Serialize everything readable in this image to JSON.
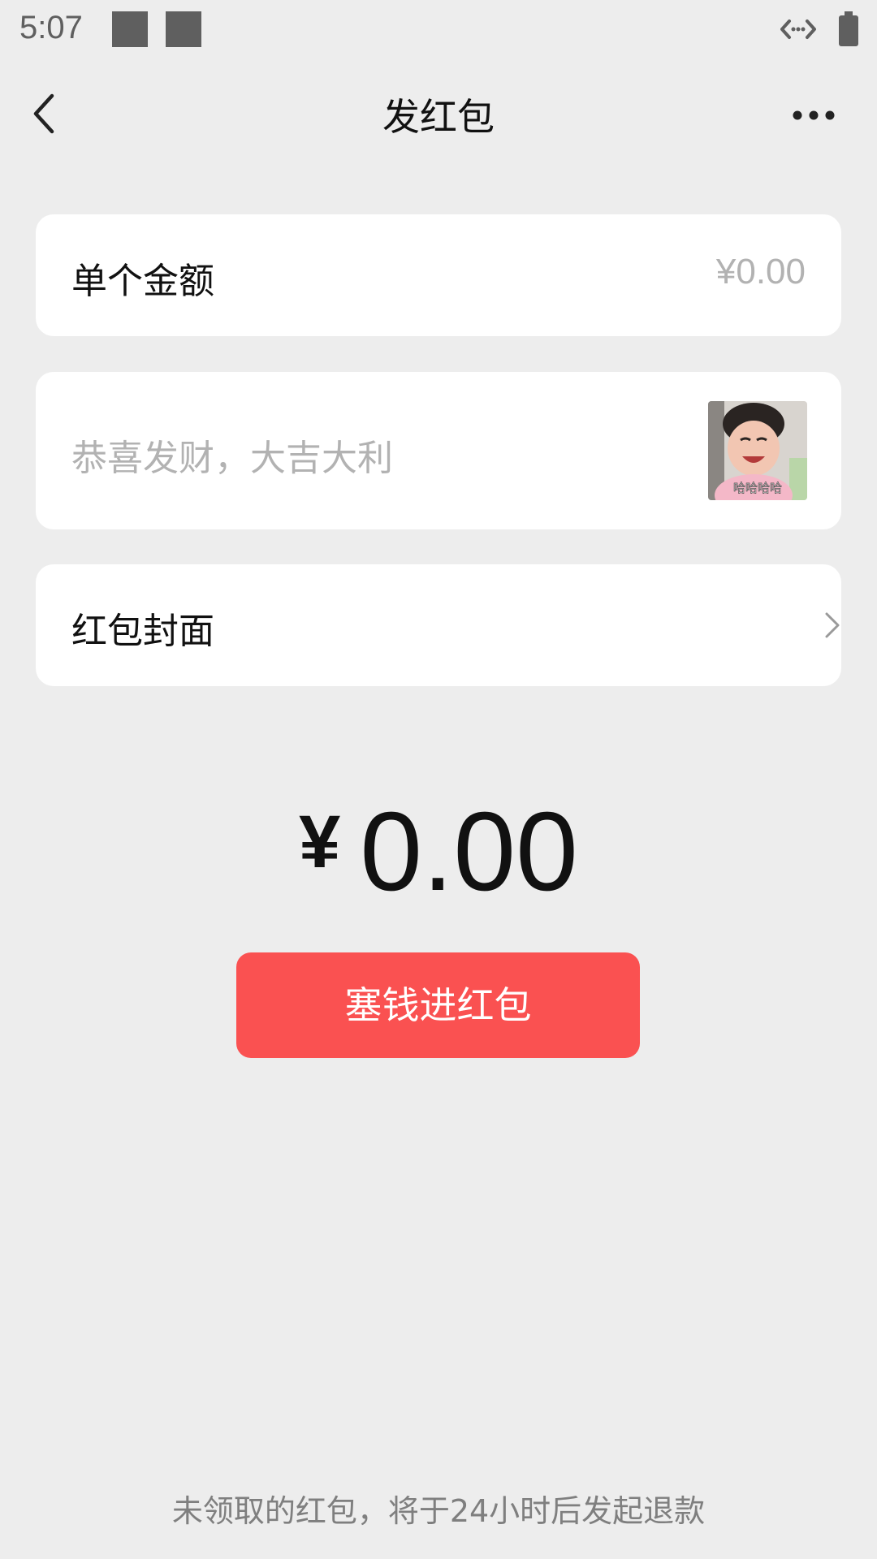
{
  "status_bar": {
    "time": "5:07"
  },
  "header": {
    "title": "发红包"
  },
  "amount_card": {
    "label": "单个金额",
    "placeholder": "¥0.00"
  },
  "greeting_card": {
    "placeholder": "恭喜发财，大吉大利",
    "sticker_caption": "哈哈哈哈"
  },
  "cover_card": {
    "label": "红包封面"
  },
  "total": {
    "currency": "¥",
    "value": "0.00"
  },
  "primary_button": {
    "label": "塞钱进红包",
    "color": "#fa5151"
  },
  "footer": {
    "note": "未领取的红包，将于24小时后发起退款"
  },
  "icons": {
    "back": "back-arrow-icon",
    "more": "more-dots-icon",
    "chevron": "chevron-right-icon",
    "battery": "battery-icon",
    "data": "data-transfer-icon"
  },
  "colors": {
    "background": "#ededed",
    "card": "#ffffff",
    "placeholder": "#b2b2b2",
    "accent": "#fa5151"
  }
}
